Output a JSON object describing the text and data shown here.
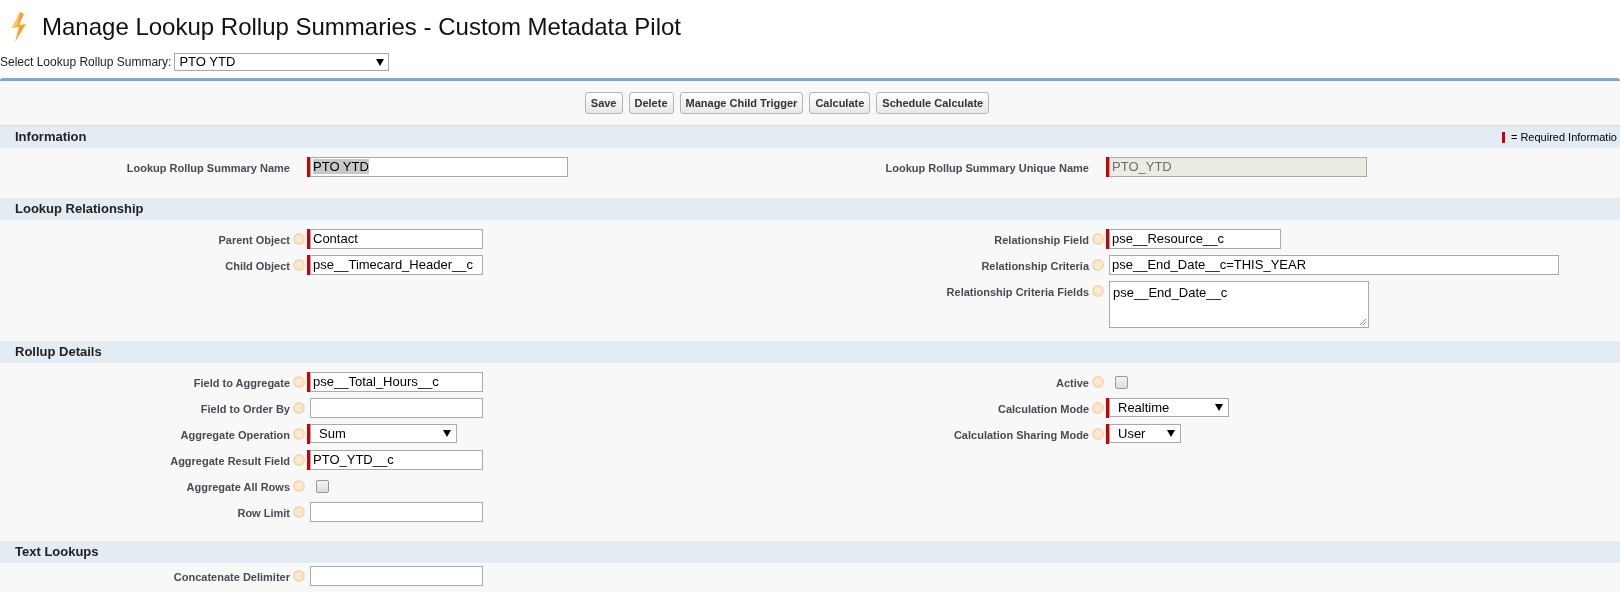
{
  "page": {
    "title": "Manage Lookup Rollup Summaries - Custom Metadata Pilot"
  },
  "picker": {
    "label": "Select Lookup Rollup Summary:",
    "value": "PTO YTD"
  },
  "buttons": [
    "Save",
    "Delete",
    "Manage Child Trigger",
    "Calculate",
    "Schedule Calculate"
  ],
  "legend": "= Required Informatio",
  "sections": [
    {
      "title": "Information",
      "legend": true,
      "left": [
        {
          "label": "Lookup Rollup Summary Name",
          "kind": "text",
          "value": "PTO YTD",
          "required": true,
          "help": false,
          "highlighted": true
        }
      ],
      "right": [
        {
          "label": "Lookup Rollup Summary Unique Name",
          "kind": "text",
          "value": "PTO_YTD",
          "required": true,
          "help": false,
          "disabled": true
        }
      ]
    },
    {
      "title": "Lookup Relationship",
      "left": [
        {
          "label": "Parent Object",
          "kind": "text",
          "value": "Contact",
          "required": true,
          "help": true
        },
        {
          "label": "Child Object",
          "kind": "text",
          "value": "pse__Timecard_Header__c",
          "required": true,
          "help": true
        }
      ],
      "right": [
        {
          "label": "Relationship Field",
          "kind": "text",
          "value": "pse__Resource__c",
          "required": true,
          "help": true
        },
        {
          "label": "Relationship Criteria",
          "kind": "text",
          "value": "pse__End_Date__c=THIS_YEAR",
          "required": false,
          "help": true
        },
        {
          "label": "Relationship Criteria Fields",
          "kind": "textarea",
          "value": "pse__End_Date__c",
          "required": false,
          "help": true
        }
      ]
    },
    {
      "title": "Rollup Details",
      "left": [
        {
          "label": "Field to Aggregate",
          "kind": "text",
          "value": "pse__Total_Hours__c",
          "required": true,
          "help": true
        },
        {
          "label": "Field to Order By",
          "kind": "text",
          "required": false,
          "help": true
        },
        {
          "label": "Aggregate Operation",
          "kind": "select",
          "value": "Sum",
          "required": true,
          "help": true
        },
        {
          "label": "Aggregate Result Field",
          "kind": "text",
          "value": "PTO_YTD__c",
          "required": true,
          "help": true
        },
        {
          "label": "Aggregate All Rows",
          "kind": "checkbox",
          "checked": false,
          "required": false,
          "help": true
        },
        {
          "label": "Row Limit",
          "kind": "text",
          "required": false,
          "help": true
        }
      ],
      "right": [
        {
          "label": "Active",
          "kind": "checkbox",
          "checked": false,
          "required": false,
          "help": true
        },
        {
          "label": "Calculation Mode",
          "kind": "select",
          "value": "Realtime",
          "required": true,
          "help": true
        },
        {
          "label": "Calculation Sharing Mode",
          "kind": "select",
          "value": "User",
          "required": true,
          "help": true
        }
      ]
    },
    {
      "title": "Text Lookups",
      "left": [
        {
          "label": "Concatenate Delimiter",
          "kind": "text",
          "required": false,
          "help": true
        }
      ]
    }
  ]
}
